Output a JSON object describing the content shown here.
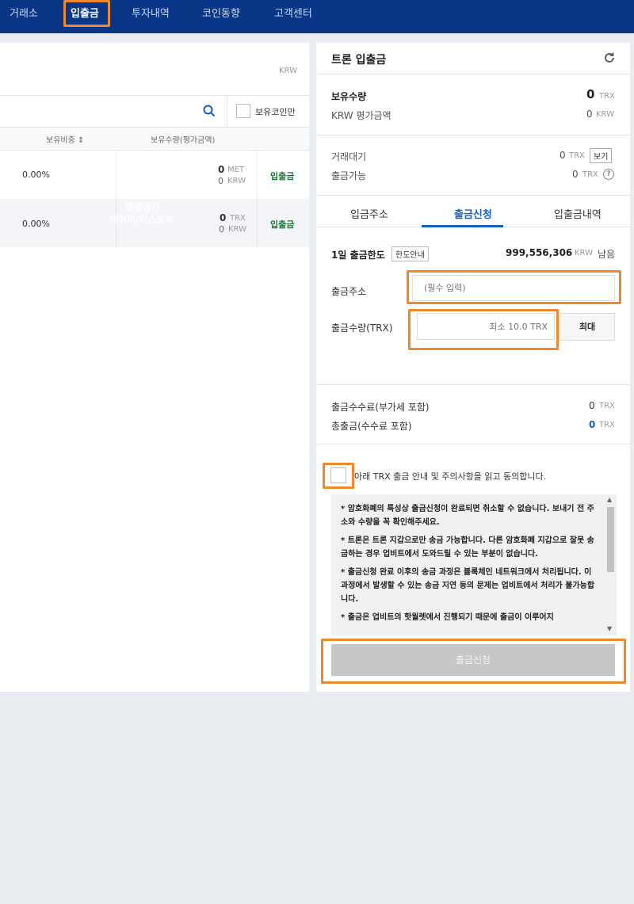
{
  "nav": {
    "items": [
      {
        "label": "거래소"
      },
      {
        "label": "입출금"
      },
      {
        "label": "투자내역"
      },
      {
        "label": "코인동향"
      },
      {
        "label": "고객센터"
      }
    ]
  },
  "left": {
    "total_unit": "KRW",
    "owned_only_label": "보유코인만",
    "col_ratio": "보유비중 ⇕",
    "col_amount": "보유수량(평가금액)",
    "rows": [
      {
        "ratio": "0.00%",
        "qty": "0",
        "qty_unit": "MET",
        "krw": "0",
        "krw_unit": "KRW",
        "action": "입출금"
      },
      {
        "ratio": "0.00%",
        "qty": "0",
        "qty_unit": "TRX",
        "krw": "0",
        "krw_unit": "KRW",
        "action": "입출금"
      }
    ],
    "watermark": [
      "영상공간",
      "네이버/티스토리"
    ]
  },
  "right": {
    "title": "트론 입출금",
    "holding_label": "보유수량",
    "holding_value": "0",
    "holding_unit": "TRX",
    "krw_eval_label": "KRW 평가금액",
    "krw_eval_value": "0",
    "krw_eval_unit": "KRW",
    "pending_label": "거래대기",
    "pending_value": "0",
    "pending_unit": "TRX",
    "view_button": "보기",
    "withdrawable_label": "출금가능",
    "withdrawable_value": "0",
    "withdrawable_unit": "TRX",
    "help_icon": "?",
    "tabs": [
      "입금주소",
      "출금신청",
      "입출금내역"
    ],
    "limit_label": "1일 출금한도",
    "limit_button": "한도안내",
    "limit_value": "999,556,306",
    "limit_unit": "KRW",
    "limit_suffix": "남음",
    "address_label": "출금주소",
    "address_placeholder": "(필수 입력)",
    "amount_label": "출금수량(TRX)",
    "amount_placeholder": "최소 10.0 TRX",
    "max_button": "최대",
    "fee_label": "출금수수료(부가세 포함)",
    "fee_value": "0",
    "fee_unit": "TRX",
    "total_label": "총출금(수수료 포함)",
    "total_value": "0",
    "total_unit": "TRX",
    "agree_text": "아래 TRX 출금 안내 및 주의사항을 읽고 동의합니다.",
    "notices": [
      "* 암호화폐의 특성상 출금신청이 완료되면 취소할 수 없습니다. 보내기 전 주소와 수량을 꼭 확인해주세요.",
      "* 트론은 트론 지갑으로만 송금 가능합니다. 다른 암호화폐 지갑으로 잘못 송금하는 경우 업비트에서 도와드릴 수 있는 부분이 없습니다.",
      "* 출금신청 완료 이후의 송금 과정은 블록체인 네트워크에서 처리됩니다. 이 과정에서 발생할 수 있는 송금 지연 등의 문제는 업비트에서 처리가 불가능합니다.",
      "* 출금은 업비트의 핫월렛에서 진행되기 때문에 출금이 이루어지"
    ],
    "submit_button": "출금신청"
  },
  "colors": {
    "nav_bg": "#093687",
    "accent_blue": "#1261c4",
    "highlight": "#ef8a2c",
    "green": "#1a7a34"
  }
}
